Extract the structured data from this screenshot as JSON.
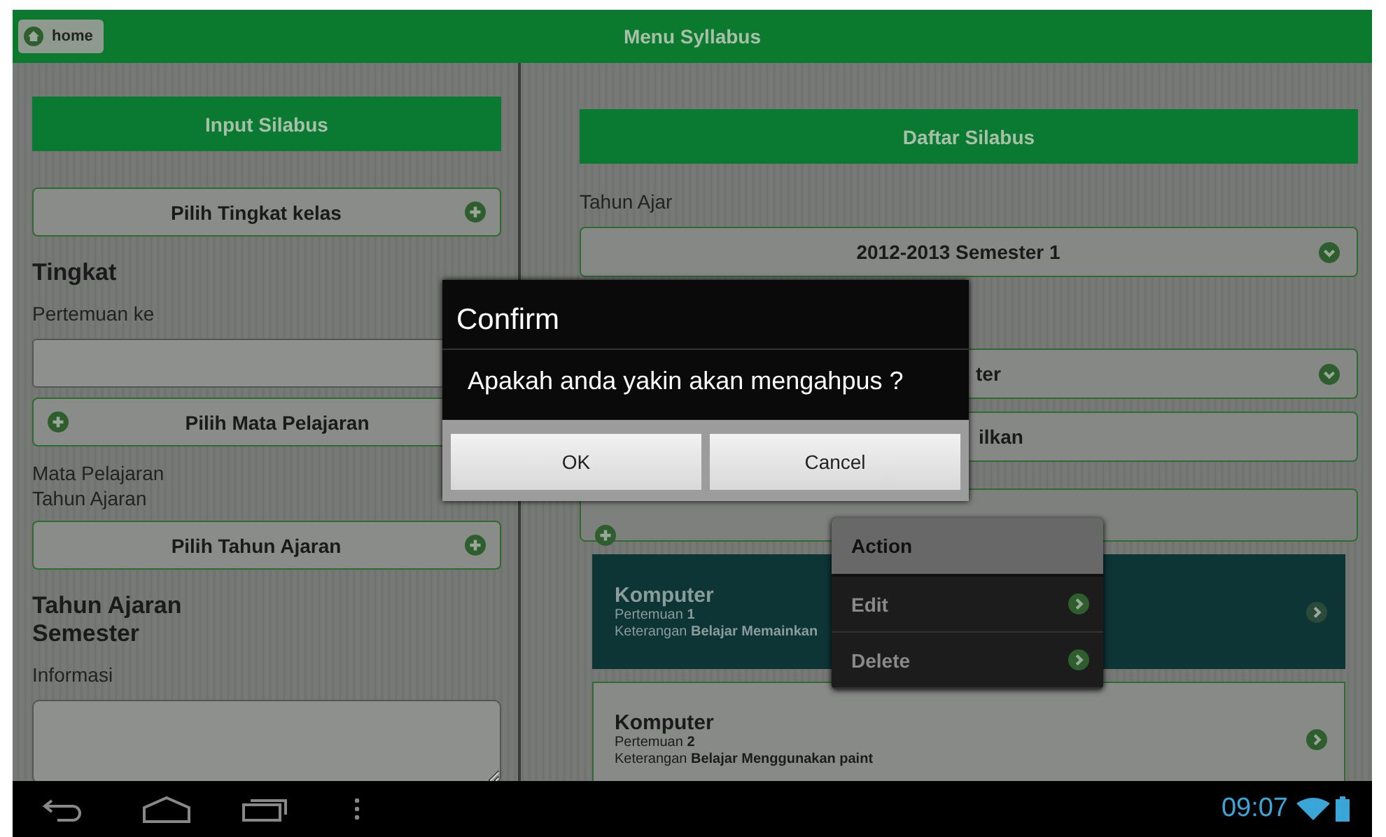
{
  "header": {
    "home_button": "home",
    "title": "Menu Syllabus"
  },
  "input_panel": {
    "title": "Input Silabus",
    "items": [
      {
        "kind": "picker",
        "label": "Pilih Tingkat kelas",
        "icon_left": false
      },
      {
        "kind": "heading",
        "text": "Tingkat"
      },
      {
        "kind": "label",
        "text": "Pertemuan ke"
      },
      {
        "kind": "field"
      },
      {
        "kind": "picker",
        "label": "Pilih Mata Pelajaran",
        "icon_left": true
      },
      {
        "kind": "label",
        "text": "Mata Pelajaran"
      },
      {
        "kind": "label",
        "text": "Tahun Ajaran"
      },
      {
        "kind": "picker",
        "label": "Pilih Tahun Ajaran",
        "icon_left": false
      },
      {
        "kind": "heading",
        "text": "Tahun Ajaran"
      },
      {
        "kind": "heading",
        "text": "Semester"
      },
      {
        "kind": "label",
        "text": "Informasi"
      },
      {
        "kind": "textarea"
      }
    ]
  },
  "list_panel": {
    "title": "Daftar Silabus",
    "year_label": "Tahun Ajar",
    "year_dropdown": "2012-2013  Semester 1",
    "subject_dropdown": "ter",
    "show_button": "ilkan",
    "items": [
      {
        "title": "Komputer",
        "meeting": "Pertemuan **1**",
        "note": "Keterangan **Belajar Memainkan**",
        "selected": true
      },
      {
        "title": "Komputer",
        "meeting": "Pertemuan **2**",
        "note": "Keterangan **Belajar Menggunakan paint**",
        "selected": false
      }
    ]
  },
  "dialog": {
    "title": "Confirm",
    "message": "Apakah anda yakin akan mengahpus ?",
    "buttons": [
      "OK",
      "Cancel"
    ]
  },
  "context_menu": {
    "title": "Action",
    "items": [
      "Edit",
      "Delete"
    ]
  },
  "status_bar": {
    "time": "09:07"
  }
}
